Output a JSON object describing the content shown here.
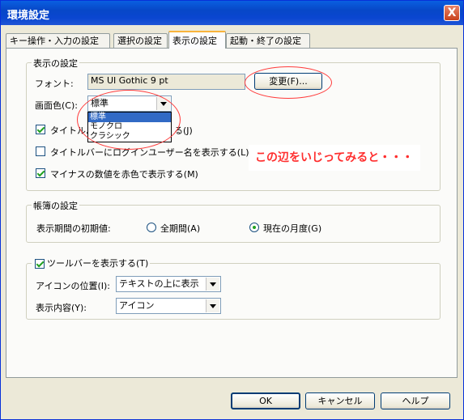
{
  "window": {
    "title": "環境設定",
    "close_label": "X"
  },
  "tabs": [
    {
      "label": "キー操作・入力の設定"
    },
    {
      "label": "選択の設定"
    },
    {
      "label": "表示の設定"
    },
    {
      "label": "起動・終了の設定"
    }
  ],
  "display_settings": {
    "group_label": "表示の設定",
    "font_label": "フォント:",
    "font_value": "MS UI Gothic   9 pt",
    "change_button": "変更(F)...",
    "color_label": "画面色(C):",
    "color_value": "標準",
    "color_options": [
      "標準",
      "モノクロ",
      "クラシック"
    ],
    "selected_option": "標準",
    "titlebar_check1_label": "タイトルバ",
    "titlebar_check1_suffix": "る(J)",
    "titlebar_check1_checked": true,
    "titlebar_check2_label": "タイトルバーにログインユーザー名を表示する(L)",
    "titlebar_check2_checked": false,
    "negative_red_label": "マイナスの数値を赤色で表示する(M)",
    "negative_red_checked": true
  },
  "annotation": {
    "text": "この辺をいじってみると・・・",
    "color": "#ff2e2e"
  },
  "ledger": {
    "group_label": "帳簿の設定",
    "period_label": "表示期間の初期値:",
    "options": [
      {
        "label": "全期間(A)",
        "selected": false
      },
      {
        "label": "現在の月度(G)",
        "selected": true
      }
    ]
  },
  "toolbar": {
    "show_label": "ツールバーを表示する(T)",
    "show_checked": true,
    "icon_pos_label": "アイコンの位置(I):",
    "icon_pos_value": "テキストの上に表示",
    "content_label": "表示内容(Y):",
    "content_value": "アイコン"
  },
  "buttons": {
    "ok": "OK",
    "cancel": "キャンセル",
    "help": "ヘルプ"
  },
  "colors": {
    "title_bar": "#0747c7",
    "accent_tab": "#f9b43c",
    "highlight": "#316ac5",
    "annotation_ring": "#ff3b3b"
  }
}
